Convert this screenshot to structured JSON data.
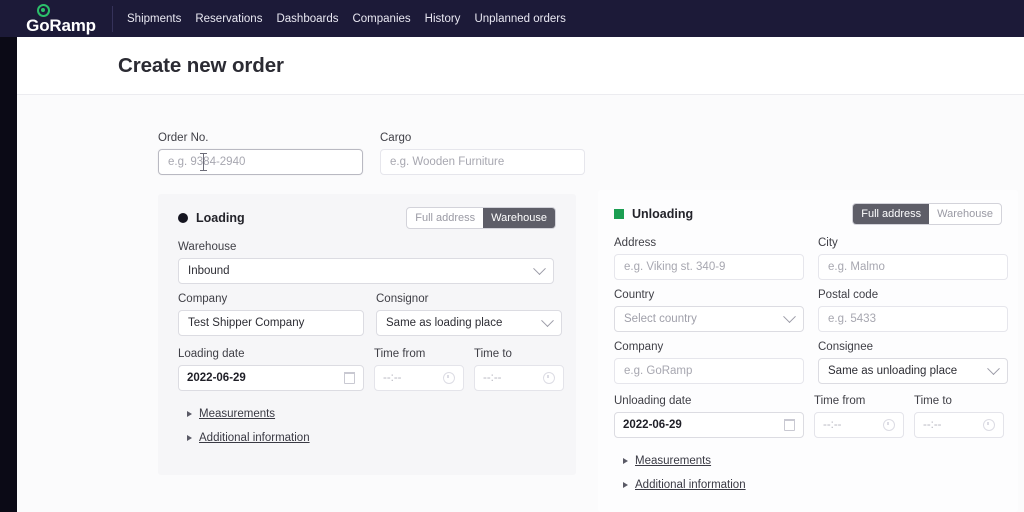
{
  "brand": {
    "name": "GoRamp",
    "logo_color": "#2bbf6a"
  },
  "nav": {
    "items": [
      {
        "label": "Shipments"
      },
      {
        "label": "Reservations"
      },
      {
        "label": "Dashboards"
      },
      {
        "label": "Companies"
      },
      {
        "label": "History"
      },
      {
        "label": "Unplanned orders"
      }
    ]
  },
  "page": {
    "title": "Create new order"
  },
  "top_fields": {
    "order_no": {
      "label": "Order No.",
      "placeholder": "e.g. 9384-2940",
      "value": ""
    },
    "cargo": {
      "label": "Cargo",
      "placeholder": "e.g. Wooden Furniture",
      "value": ""
    }
  },
  "loading": {
    "title": "Loading",
    "marker_color": "#141420",
    "segmented": {
      "options": [
        "Full address",
        "Warehouse"
      ],
      "selected": "Warehouse"
    },
    "warehouse": {
      "label": "Warehouse",
      "value": "Inbound"
    },
    "company": {
      "label": "Company",
      "value": "Test Shipper Company"
    },
    "consignor": {
      "label": "Consignor",
      "value": "Same as loading place"
    },
    "date": {
      "label": "Loading date",
      "value": "2022-06-29"
    },
    "time_from": {
      "label": "Time from",
      "value": "--:--"
    },
    "time_to": {
      "label": "Time to",
      "value": "--:--"
    },
    "disclosures": [
      {
        "label": "Measurements"
      },
      {
        "label": "Additional information"
      }
    ]
  },
  "unloading": {
    "title": "Unloading",
    "marker_color": "#1b9e52",
    "segmented": {
      "options": [
        "Full address",
        "Warehouse"
      ],
      "selected": "Full address"
    },
    "address": {
      "label": "Address",
      "placeholder": "e.g. Viking st. 340-9",
      "value": ""
    },
    "city": {
      "label": "City",
      "placeholder": "e.g. Malmo",
      "value": ""
    },
    "country": {
      "label": "Country",
      "value": "Select country"
    },
    "postal_code": {
      "label": "Postal code",
      "placeholder": "e.g. 5433",
      "value": ""
    },
    "company": {
      "label": "Company",
      "placeholder": "e.g. GoRamp",
      "value": ""
    },
    "consignee": {
      "label": "Consignee",
      "value": "Same as unloading place"
    },
    "date": {
      "label": "Unloading date",
      "value": "2022-06-29"
    },
    "time_from": {
      "label": "Time from",
      "value": "--:--"
    },
    "time_to": {
      "label": "Time to",
      "value": "--:--"
    },
    "disclosures": [
      {
        "label": "Measurements"
      },
      {
        "label": "Additional information"
      }
    ]
  }
}
